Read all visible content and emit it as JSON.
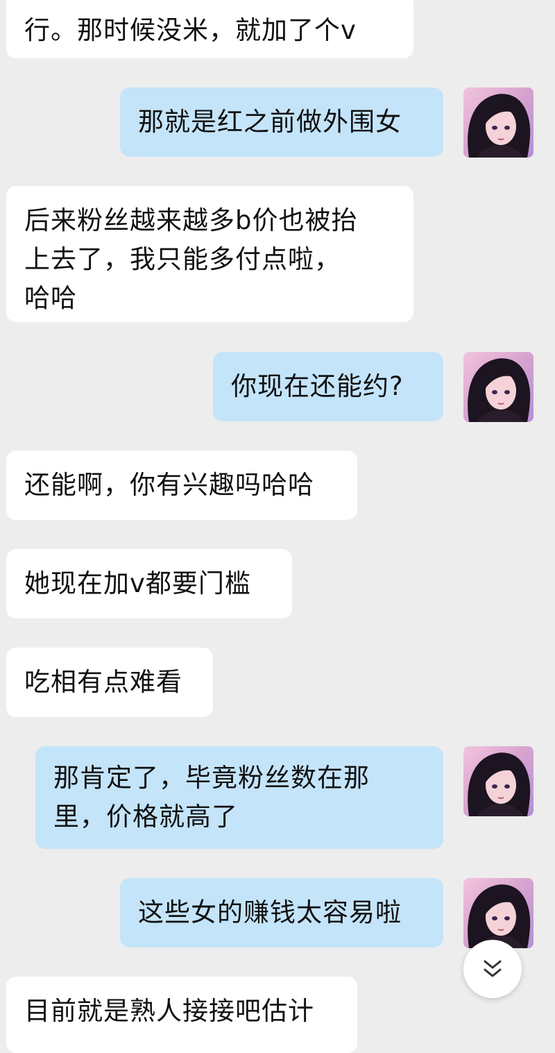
{
  "conversation": {
    "messages": [
      {
        "side": "in",
        "text": "行。那时候没米，就加了个v"
      },
      {
        "side": "out",
        "text": "那就是红之前做外围女"
      },
      {
        "side": "in",
        "text": "后来粉丝越来越多b价也被抬\n上去了，我只能多付点啦，\n哈哈"
      },
      {
        "side": "out",
        "text": "你现在还能约?"
      },
      {
        "side": "in",
        "text": "还能啊，你有兴趣吗哈哈"
      },
      {
        "side": "in",
        "text": "她现在加v都要门槛"
      },
      {
        "side": "in",
        "text": "吃相有点难看"
      },
      {
        "side": "out",
        "text": "那肯定了，毕竟粉丝数在那\n里，价格就高了"
      },
      {
        "side": "out",
        "text": "这些女的赚钱太容易啦"
      },
      {
        "side": "in",
        "text": "目前就是熟人接接吧估计"
      }
    ]
  },
  "icons": {
    "avatar": "anime-girl-avatar-icon",
    "scroll": "double-chevron-down-icon"
  },
  "colors": {
    "background": "#ededed",
    "incoming_bubble": "#ffffff",
    "outgoing_bubble": "#c4e4fa"
  }
}
